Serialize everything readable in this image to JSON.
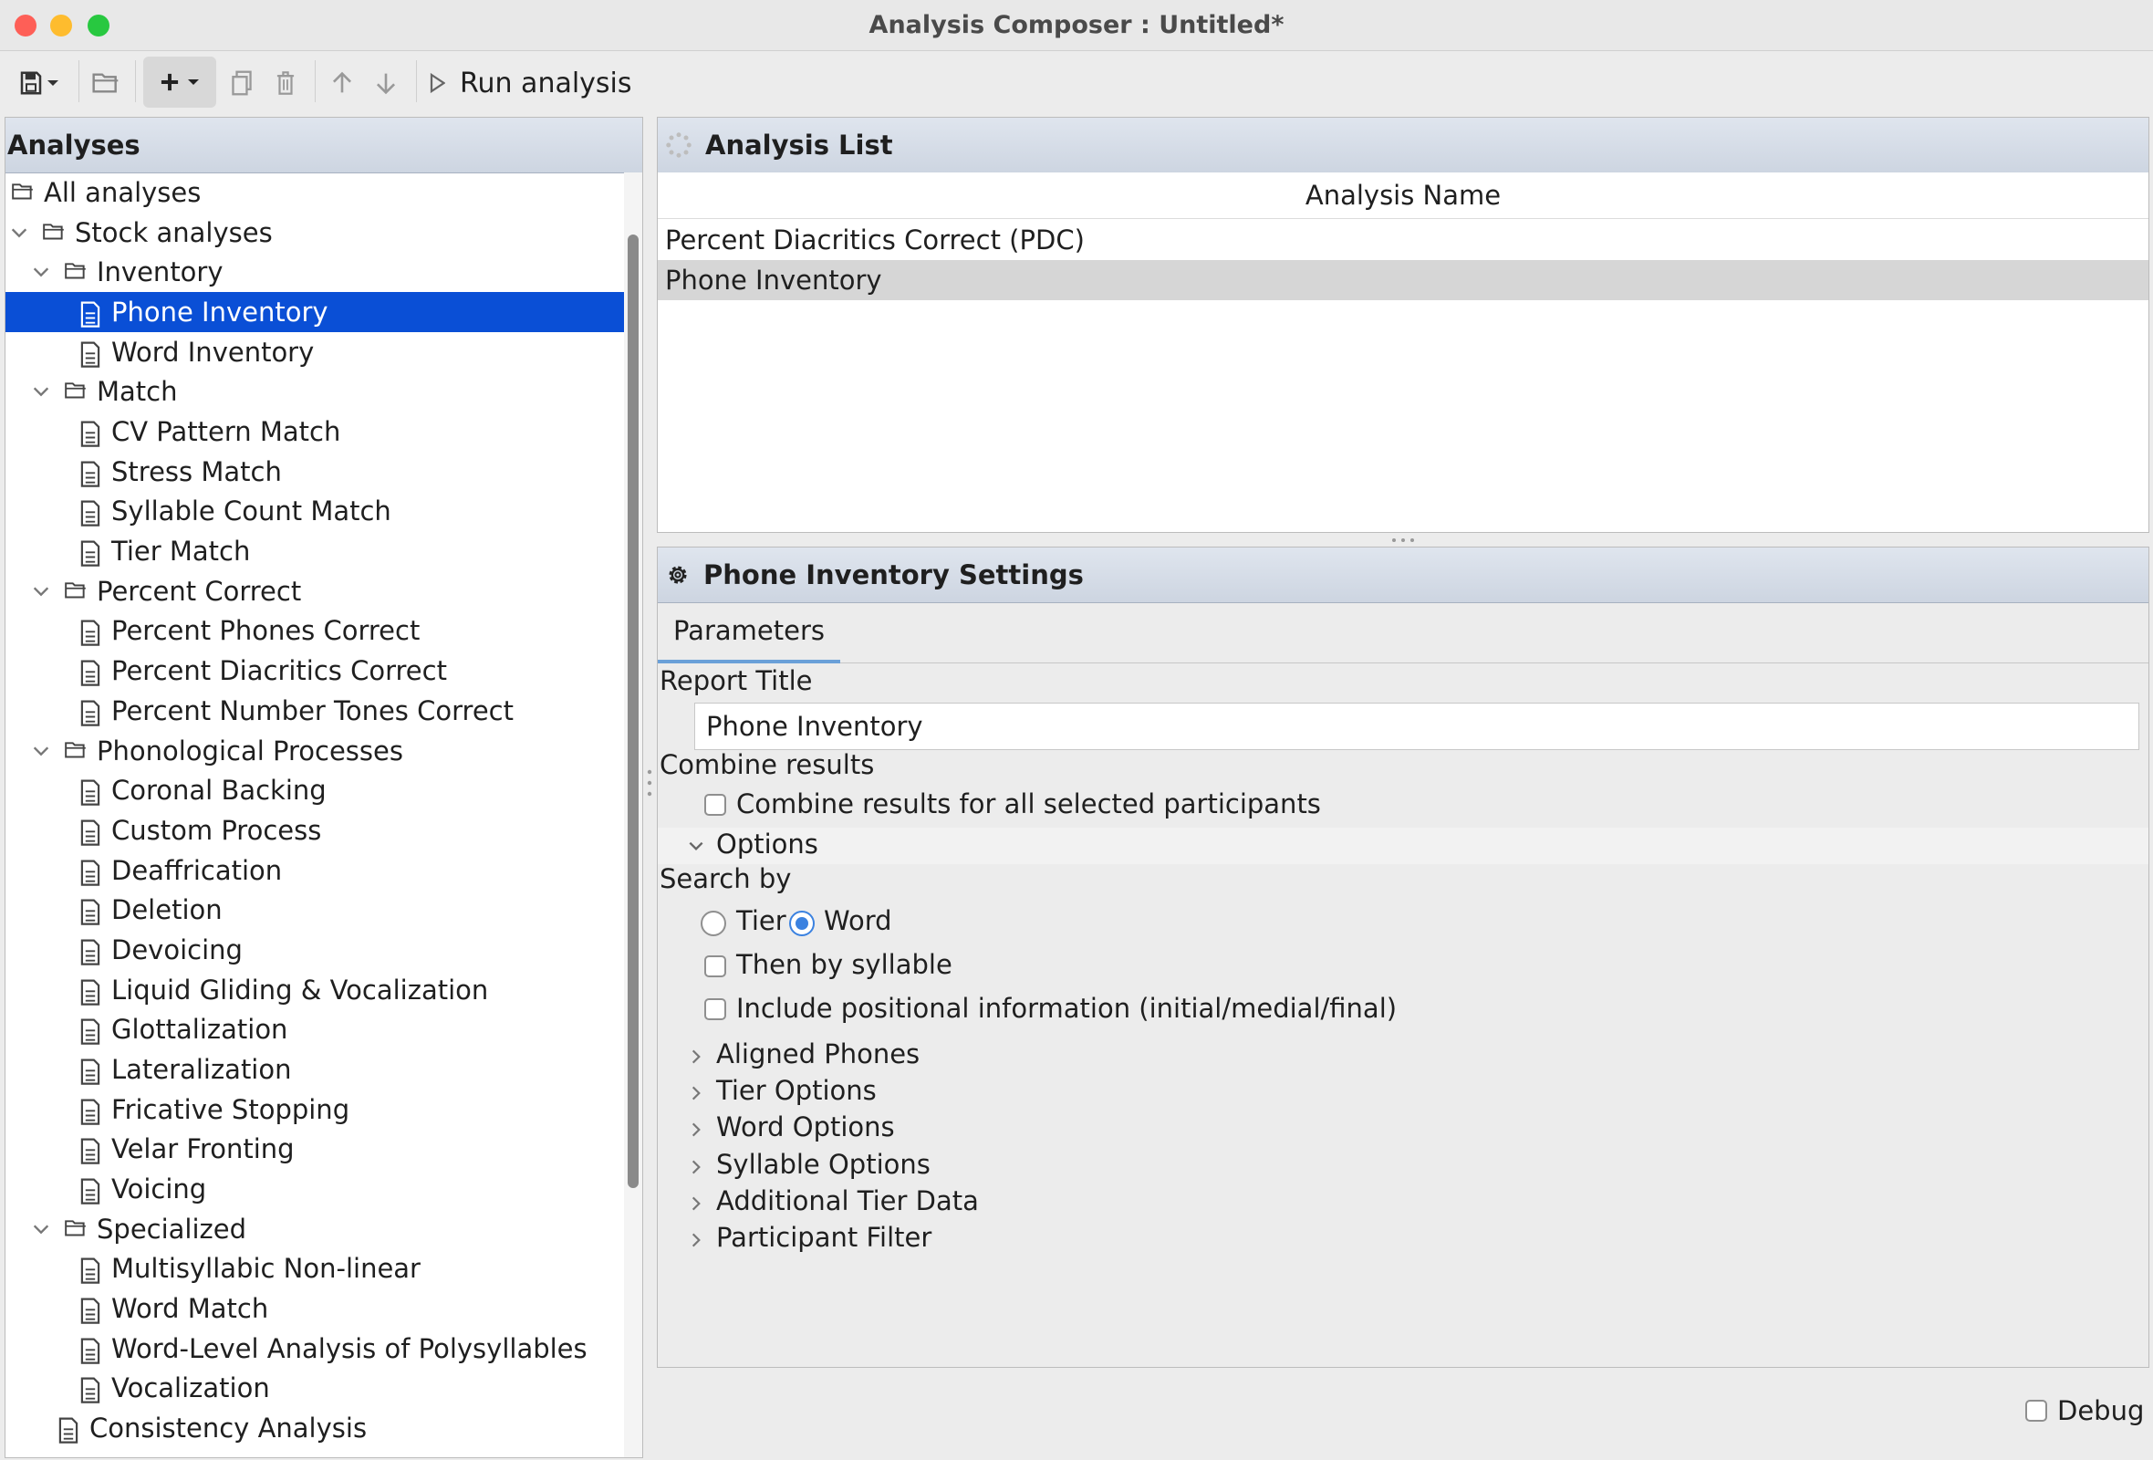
{
  "window": {
    "title": "Analysis Composer : Untitled*",
    "traffic_colors": [
      "#fe5f57",
      "#febc2e",
      "#28c840"
    ]
  },
  "toolbar": {
    "items": [
      "save-icon",
      "open-folder-icon",
      "add-icon",
      "copy-icon",
      "trash-icon",
      "arrow-up-icon",
      "arrow-down-icon",
      "play-icon"
    ],
    "run_label": "Run analysis"
  },
  "left_panel": {
    "title": "Analyses",
    "tree": [
      {
        "label": "All analyses",
        "type": "folder",
        "depth": 0,
        "expanded": null
      },
      {
        "label": "Stock analyses",
        "type": "folder",
        "depth": 1,
        "expanded": true
      },
      {
        "label": "Inventory",
        "type": "folder",
        "depth": 2,
        "expanded": true
      },
      {
        "label": "Phone Inventory",
        "type": "doc",
        "depth": 3,
        "selected": true
      },
      {
        "label": "Word Inventory",
        "type": "doc",
        "depth": 3
      },
      {
        "label": "Match",
        "type": "folder",
        "depth": 2,
        "expanded": true
      },
      {
        "label": "CV Pattern Match",
        "type": "doc",
        "depth": 3
      },
      {
        "label": "Stress Match",
        "type": "doc",
        "depth": 3
      },
      {
        "label": "Syllable Count Match",
        "type": "doc",
        "depth": 3
      },
      {
        "label": "Tier Match",
        "type": "doc",
        "depth": 3
      },
      {
        "label": "Percent Correct",
        "type": "folder",
        "depth": 2,
        "expanded": true
      },
      {
        "label": "Percent Phones Correct",
        "type": "doc",
        "depth": 3
      },
      {
        "label": "Percent Diacritics Correct",
        "type": "doc",
        "depth": 3
      },
      {
        "label": "Percent Number Tones Correct",
        "type": "doc",
        "depth": 3
      },
      {
        "label": "Phonological Processes",
        "type": "folder",
        "depth": 2,
        "expanded": true
      },
      {
        "label": "Coronal Backing",
        "type": "doc",
        "depth": 3
      },
      {
        "label": "Custom Process",
        "type": "doc",
        "depth": 3
      },
      {
        "label": "Deaffrication",
        "type": "doc",
        "depth": 3
      },
      {
        "label": "Deletion",
        "type": "doc",
        "depth": 3
      },
      {
        "label": "Devoicing",
        "type": "doc",
        "depth": 3
      },
      {
        "label": "Liquid Gliding & Vocalization",
        "type": "doc",
        "depth": 3
      },
      {
        "label": "Glottalization",
        "type": "doc",
        "depth": 3
      },
      {
        "label": "Lateralization",
        "type": "doc",
        "depth": 3
      },
      {
        "label": "Fricative Stopping",
        "type": "doc",
        "depth": 3
      },
      {
        "label": "Velar Fronting",
        "type": "doc",
        "depth": 3
      },
      {
        "label": "Voicing",
        "type": "doc",
        "depth": 3
      },
      {
        "label": "Specialized",
        "type": "folder",
        "depth": 2,
        "expanded": true
      },
      {
        "label": "Multisyllabic Non-linear",
        "type": "doc",
        "depth": 3
      },
      {
        "label": "Word Match",
        "type": "doc",
        "depth": 3
      },
      {
        "label": "Word-Level Analysis of Polysyllables",
        "type": "doc",
        "depth": 3
      },
      {
        "label": "Vocalization",
        "type": "doc",
        "depth": 3
      },
      {
        "label": "Consistency Analysis",
        "type": "doc",
        "depth": 2
      }
    ]
  },
  "analysis_list": {
    "title": "Analysis List",
    "column": "Analysis Name",
    "rows": [
      "Percent Diacritics Correct (PDC)",
      "Phone Inventory"
    ],
    "selected_index": 1
  },
  "settings": {
    "title": "Phone Inventory Settings",
    "tab": "Parameters",
    "report_title_label": "Report Title",
    "report_title_value": "Phone Inventory",
    "combine_label": "Combine results",
    "combine_checkbox_label": "Combine results for all selected participants",
    "options_label": "Options",
    "search_by_label": "Search by",
    "radio_tier": "Tier",
    "radio_word": "Word",
    "then_by_syllable": "Then by syllable",
    "include_positional": "Include positional information (initial/medial/final)",
    "sections": [
      "Aligned Phones",
      "Tier Options",
      "Word Options",
      "Syllable Options",
      "Additional Tier Data",
      "Participant Filter"
    ]
  },
  "footer": {
    "debug_label": "Debug"
  },
  "colors": {
    "selection": "#0a4fd6",
    "accent": "#3b82e0",
    "list_selection": "#d6d6d6"
  }
}
